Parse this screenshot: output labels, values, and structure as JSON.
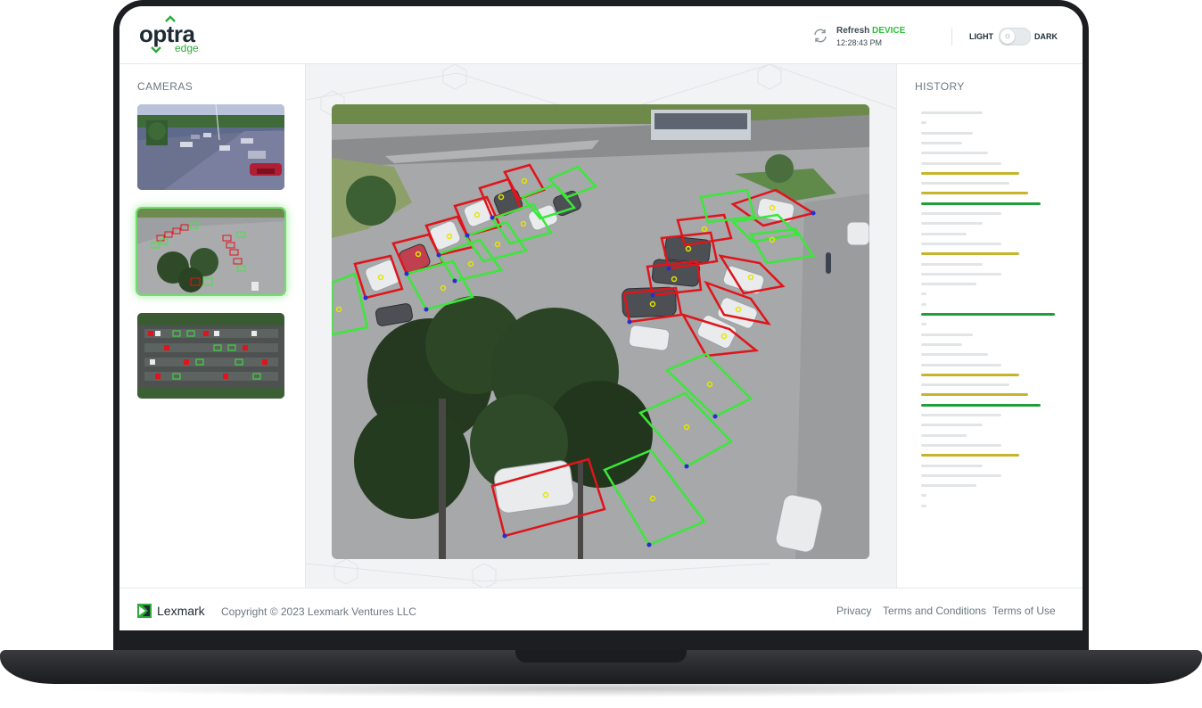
{
  "app": {
    "logo_word": "optra",
    "logo_sub": "edge"
  },
  "header": {
    "refresh_prefix": "Refresh",
    "refresh_highlight": "DEVICE",
    "refresh_time": "12:28:43 PM",
    "theme_light": "LIGHT",
    "theme_dark": "DARK",
    "theme_selected": "light"
  },
  "cameras": {
    "title": "CAMERAS",
    "selected_index": 1,
    "items": [
      "camera-1",
      "camera-2",
      "camera-3"
    ]
  },
  "history": {
    "title": "HISTORY",
    "rows": [
      {
        "status": "neutral",
        "length": 0.43
      },
      {
        "status": "neutral",
        "length": 0.04
      },
      {
        "status": "neutral",
        "length": 0.36
      },
      {
        "status": "neutral",
        "length": 0.29
      },
      {
        "status": "neutral",
        "length": 0.47
      },
      {
        "status": "neutral",
        "length": 0.56
      },
      {
        "status": "warning",
        "length": 0.69
      },
      {
        "status": "neutral",
        "length": 0.62
      },
      {
        "status": "warning",
        "length": 0.75
      },
      {
        "status": "ok",
        "length": 0.84
      },
      {
        "status": "neutral",
        "length": 0.56
      },
      {
        "status": "neutral",
        "length": 0.43
      },
      {
        "status": "neutral",
        "length": 0.32
      },
      {
        "status": "neutral",
        "length": 0.56
      },
      {
        "status": "warning",
        "length": 0.69
      },
      {
        "status": "neutral",
        "length": 0.43
      },
      {
        "status": "neutral",
        "length": 0.56
      },
      {
        "status": "neutral",
        "length": 0.39
      },
      {
        "status": "neutral",
        "length": 0.04
      },
      {
        "status": "neutral",
        "length": 0.04
      },
      {
        "status": "ok",
        "length": 0.94
      },
      {
        "status": "neutral",
        "length": 0.04
      },
      {
        "status": "neutral",
        "length": 0.36
      },
      {
        "status": "neutral",
        "length": 0.29
      },
      {
        "status": "neutral",
        "length": 0.47
      },
      {
        "status": "neutral",
        "length": 0.56
      },
      {
        "status": "warning",
        "length": 0.69
      },
      {
        "status": "neutral",
        "length": 0.62
      },
      {
        "status": "warning",
        "length": 0.75
      },
      {
        "status": "ok",
        "length": 0.84
      },
      {
        "status": "neutral",
        "length": 0.56
      },
      {
        "status": "neutral",
        "length": 0.43
      },
      {
        "status": "neutral",
        "length": 0.32
      },
      {
        "status": "neutral",
        "length": 0.56
      },
      {
        "status": "warning",
        "length": 0.69
      },
      {
        "status": "neutral",
        "length": 0.43
      },
      {
        "status": "neutral",
        "length": 0.56
      },
      {
        "status": "neutral",
        "length": 0.39
      },
      {
        "status": "neutral",
        "length": 0.04
      },
      {
        "status": "neutral",
        "length": 0.04
      }
    ]
  },
  "footer": {
    "brand": "Lexmark",
    "copyright": "Copyright © 2023 Lexmark Ventures LLC",
    "links": [
      "Privacy",
      "Terms and Conditions",
      "Terms of Use"
    ]
  },
  "colors": {
    "accent": "#2fbf3a",
    "occupied": "#e0141b",
    "vacant": "#3be83a",
    "history_neutral": "#e2e5e8",
    "history_warning": "#c8b42c",
    "history_ok": "#1f9e3a"
  }
}
